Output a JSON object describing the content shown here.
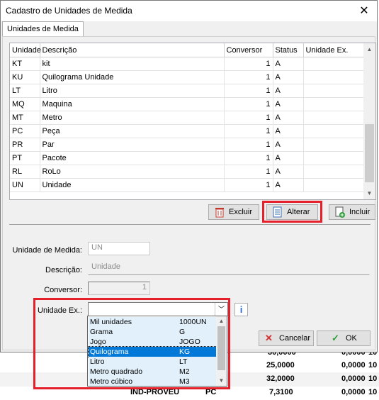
{
  "window": {
    "title": "Cadastro de Unidades de Medida",
    "close_glyph": "✕"
  },
  "tab": {
    "label": "Unidades de Medida"
  },
  "grid": {
    "columns": [
      "Unidade",
      "Descrição",
      "Conversor",
      "Status",
      "Unidade Ex."
    ],
    "rows": [
      {
        "unidade": "KT",
        "descricao": "kit",
        "conversor": "1",
        "status": "A",
        "unidade_ex": ""
      },
      {
        "unidade": "KU",
        "descricao": "Quilograma Unidade",
        "conversor": "1",
        "status": "A",
        "unidade_ex": ""
      },
      {
        "unidade": "LT",
        "descricao": "Litro",
        "conversor": "1",
        "status": "A",
        "unidade_ex": ""
      },
      {
        "unidade": "MQ",
        "descricao": "Maquina",
        "conversor": "1",
        "status": "A",
        "unidade_ex": ""
      },
      {
        "unidade": "MT",
        "descricao": "Metro",
        "conversor": "1",
        "status": "A",
        "unidade_ex": ""
      },
      {
        "unidade": "PC",
        "descricao": "Peça",
        "conversor": "1",
        "status": "A",
        "unidade_ex": ""
      },
      {
        "unidade": "PR",
        "descricao": "Par",
        "conversor": "1",
        "status": "A",
        "unidade_ex": ""
      },
      {
        "unidade": "PT",
        "descricao": "Pacote",
        "conversor": "1",
        "status": "A",
        "unidade_ex": ""
      },
      {
        "unidade": "RL",
        "descricao": "RoLo",
        "conversor": "1",
        "status": "A",
        "unidade_ex": ""
      },
      {
        "unidade": "UN",
        "descricao": "Unidade",
        "conversor": "1",
        "status": "A",
        "unidade_ex": ""
      }
    ]
  },
  "buttons": {
    "excluir": "Excluir",
    "alterar": "Alterar",
    "incluir": "Incluir",
    "cancelar": "Cancelar",
    "ok": "OK"
  },
  "form": {
    "unidade_label": "Unidade de Medida:",
    "unidade_value": "UN",
    "descricao_label": "Descrição:",
    "descricao_value": "Unidade",
    "conversor_label": "Conversor:",
    "conversor_value": "1",
    "unidade_ex_label": "Unidade Ex.:",
    "unidade_ex_value": "",
    "info_glyph": "i"
  },
  "dropdown_options": [
    {
      "name": "Mil unidades",
      "code": "1000UN",
      "selected": false
    },
    {
      "name": "Grama",
      "code": "G",
      "selected": false
    },
    {
      "name": "Jogo",
      "code": "JOGO",
      "selected": false
    },
    {
      "name": "Quilograma",
      "code": "KG",
      "selected": true
    },
    {
      "name": "Litro",
      "code": "LT",
      "selected": false
    },
    {
      "name": "Metro quadrado",
      "code": "M2",
      "selected": false
    },
    {
      "name": "Metro cúbico",
      "code": "M3",
      "selected": false
    }
  ],
  "background_rows": [
    {
      "col1": "",
      "col2": "",
      "v1": "30,0000",
      "v2": "0,0000",
      "v3": "10"
    },
    {
      "col1": "",
      "col2": "",
      "v1": "25,0000",
      "v2": "0,0000",
      "v3": "10"
    },
    {
      "col1": "",
      "col2": "",
      "v1": "32,0000",
      "v2": "0,0000",
      "v3": "10"
    },
    {
      "col1": "IND-PROVEU",
      "col2": "PC",
      "v1": "7,3100",
      "v2": "0,0000",
      "v3": "10"
    }
  ],
  "colors": {
    "highlight": "#e5202a",
    "selection": "#0078d7",
    "dropdown_bg": "#e2f0fb"
  }
}
